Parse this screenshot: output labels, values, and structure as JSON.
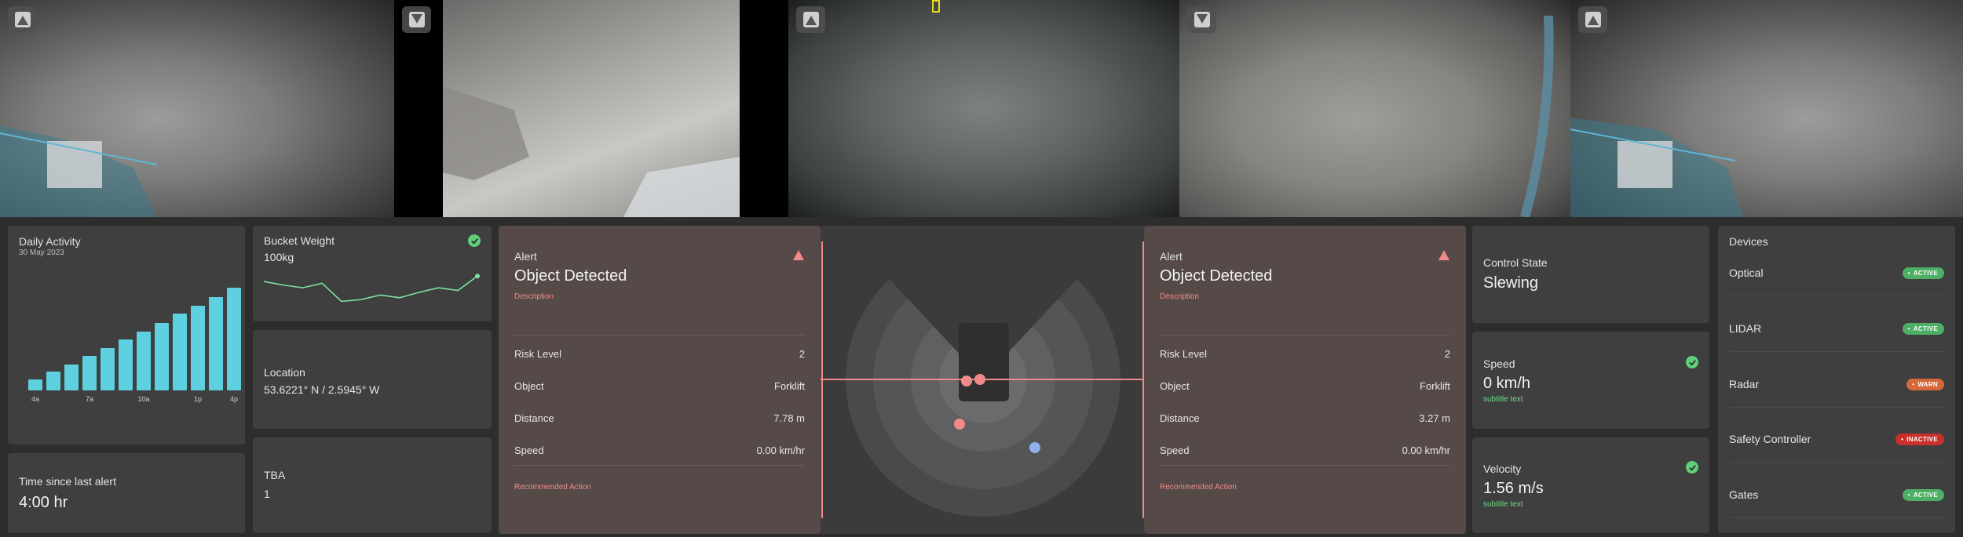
{
  "colors": {
    "bg": "#2d2d2d",
    "panel": "#3f3f3f",
    "alert_panel": "#564a48",
    "accent_cyan": "#5fd0e0",
    "alert_red": "#f08a8a",
    "ok_green": "#5fd07a",
    "warn_orange": "#d4683a",
    "inactive_red": "#c9302c"
  },
  "cameras": [
    {
      "name": "camera-1",
      "icon": "camera-view-icon"
    },
    {
      "name": "camera-2",
      "icon": "camera-view-icon"
    },
    {
      "name": "camera-3",
      "icon": "camera-view-icon"
    },
    {
      "name": "camera-4",
      "icon": "camera-view-icon"
    },
    {
      "name": "camera-5",
      "icon": "camera-view-icon"
    }
  ],
  "daily_activity": {
    "title": "Daily Activity",
    "date": "30 May 2023",
    "chart_data": {
      "type": "bar",
      "values": [
        8,
        14,
        19,
        25,
        31,
        37,
        43,
        49,
        56,
        62,
        68,
        75
      ],
      "tick_labels": [
        "4a",
        "7a",
        "10a",
        "1p",
        "4p"
      ],
      "tick_positions": [
        0,
        3,
        6,
        9,
        11
      ],
      "ylim": [
        0,
        80
      ],
      "grid": false
    }
  },
  "bucket_weight": {
    "title": "Bucket Weight",
    "value": "100kg",
    "status_icon": "check-circle-icon",
    "sparkline": [
      62,
      58,
      55,
      60,
      40,
      42,
      47,
      44,
      50,
      55,
      52,
      68
    ]
  },
  "location": {
    "title": "Location",
    "value": "53.6221° N / 2.5945° W"
  },
  "time_since_alert": {
    "title": "Time since last alert",
    "value": "4:00 hr"
  },
  "tba": {
    "title": "TBA",
    "value": "1"
  },
  "alerts": [
    {
      "label": "Alert",
      "title": "Object Detected",
      "description": "Description",
      "rows": [
        {
          "key": "Risk Level",
          "value": "2"
        },
        {
          "key": "Object",
          "value": "Forklift"
        },
        {
          "key": "Distance",
          "value": "7.78 m"
        },
        {
          "key": "Speed",
          "value": "0.00 km/hr"
        }
      ],
      "recommended": "Recommended Action"
    },
    {
      "label": "Alert",
      "title": "Object Detected",
      "description": "Description",
      "rows": [
        {
          "key": "Risk Level",
          "value": "2"
        },
        {
          "key": "Object",
          "value": "Forklift"
        },
        {
          "key": "Distance",
          "value": "3.27 m"
        },
        {
          "key": "Speed",
          "value": "0.00 km/hr"
        }
      ],
      "recommended": "Recommended Action"
    }
  ],
  "control_state": {
    "title": "Control State",
    "value": "Slewing"
  },
  "speed": {
    "title": "Speed",
    "value": "0 km/h",
    "subtitle": "subtitle text"
  },
  "velocity": {
    "title": "Velocity",
    "value": "1.56 m/s",
    "subtitle": "subtitle text"
  },
  "devices": {
    "title": "Devices",
    "items": [
      {
        "name": "Optical",
        "status": "ACTIVE",
        "color": "#4caf63"
      },
      {
        "name": "LIDAR",
        "status": "ACTIVE",
        "color": "#4caf63"
      },
      {
        "name": "Radar",
        "status": "WARN",
        "color": "#d4683a"
      },
      {
        "name": "Safety Controller",
        "status": "INACTIVE",
        "color": "#c9302c"
      },
      {
        "name": "Gates",
        "status": "ACTIVE",
        "color": "#4caf63"
      }
    ]
  }
}
